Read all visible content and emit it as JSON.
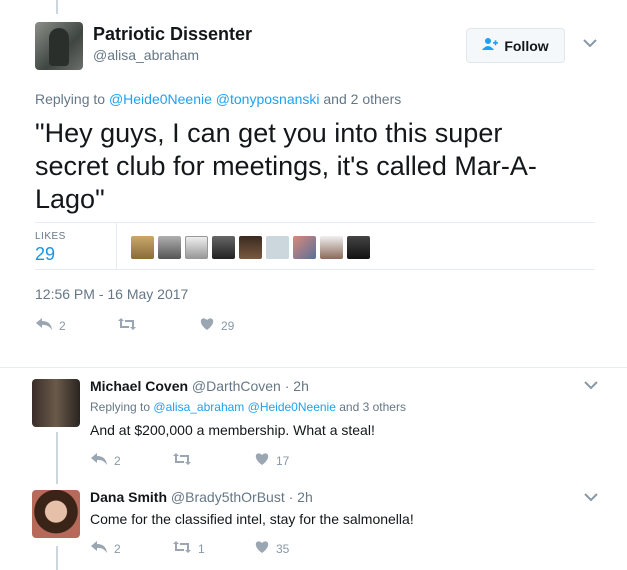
{
  "main_tweet": {
    "display_name": "Patriotic Dissenter",
    "handle": "@alisa_abraham",
    "follow_label": "Follow",
    "replying_prefix": "Replying to",
    "replying_users": [
      "@Heide0Neenie",
      "@tonyposnanski"
    ],
    "replying_suffix": "and 2 others",
    "text": "\"Hey guys, I can get you into this super secret club for meetings, it's called Mar-A-Lago\"",
    "likes_label": "LIKES",
    "likes_count": "29",
    "timestamp": "12:56 PM - 16 May 2017",
    "reply_count": "2",
    "retweet_count": "",
    "like_count": "29"
  },
  "replies": [
    {
      "display_name": "Michael Coven",
      "handle": "@DarthCoven",
      "time": "· 2h",
      "replying_prefix": "Replying to",
      "replying_users": [
        "@alisa_abraham",
        "@Heide0Neenie"
      ],
      "replying_suffix": "and 3 others",
      "text": "And at $200,000 a membership. What a steal!",
      "reply_count": "2",
      "retweet_count": "",
      "like_count": "17"
    },
    {
      "display_name": "Dana Smith",
      "handle": "@Brady5thOrBust",
      "time": "· 2h",
      "text": "Come for the classified intel, stay for the salmonella!",
      "reply_count": "2",
      "retweet_count": "1",
      "like_count": "35"
    }
  ],
  "icons": {
    "reply": "reply-icon",
    "retweet": "retweet-icon",
    "like": "heart-icon",
    "follow": "add-user-icon",
    "menu": "chevron-down-icon"
  },
  "colors": {
    "accent": "#1da1f2",
    "link": "#1b95e0",
    "muted": "#657786",
    "border": "#e6ecf0"
  }
}
